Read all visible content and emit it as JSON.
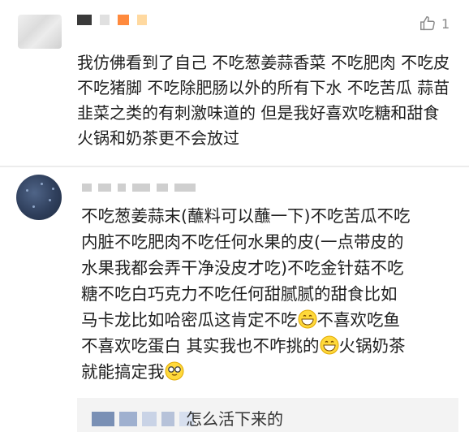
{
  "comment1": {
    "like_count": "1",
    "text": "我仿佛看到了自己 不吃葱姜蒜香菜 不吃肥肉 不吃皮 不吃猪脚 不吃除肥肠以外的所有下水 不吃苦瓜 蒜苗 韭菜之类的有刺激味道的 但是我好喜欢吃糖和甜食 火锅和奶茶更不会放过"
  },
  "comment2": {
    "line1": "不吃葱姜蒜末(蘸料可以蘸一下)不吃苦瓜不吃",
    "line2": "内脏不吃肥肉不吃任何水果的皮(一点带皮的",
    "line3": "水果我都会弄干净没皮才吃)不吃金针菇不吃",
    "line4": "糖不吃白巧克力不吃任何甜腻腻的甜食比如",
    "line5": "马卡龙比如哈密瓜这肯定不吃",
    "line5b": "不喜欢吃鱼",
    "line6": "不喜欢吃蛋白 其实我也不咋挑的",
    "line6b": "火锅奶茶",
    "line7": "就能搞定我"
  },
  "reply": {
    "text": "怎么活下来的"
  },
  "icons": [
    "thumbs-up-icon",
    "grin-emoji-icon",
    "grin-emoji-icon",
    "nerd-emoji-icon"
  ]
}
